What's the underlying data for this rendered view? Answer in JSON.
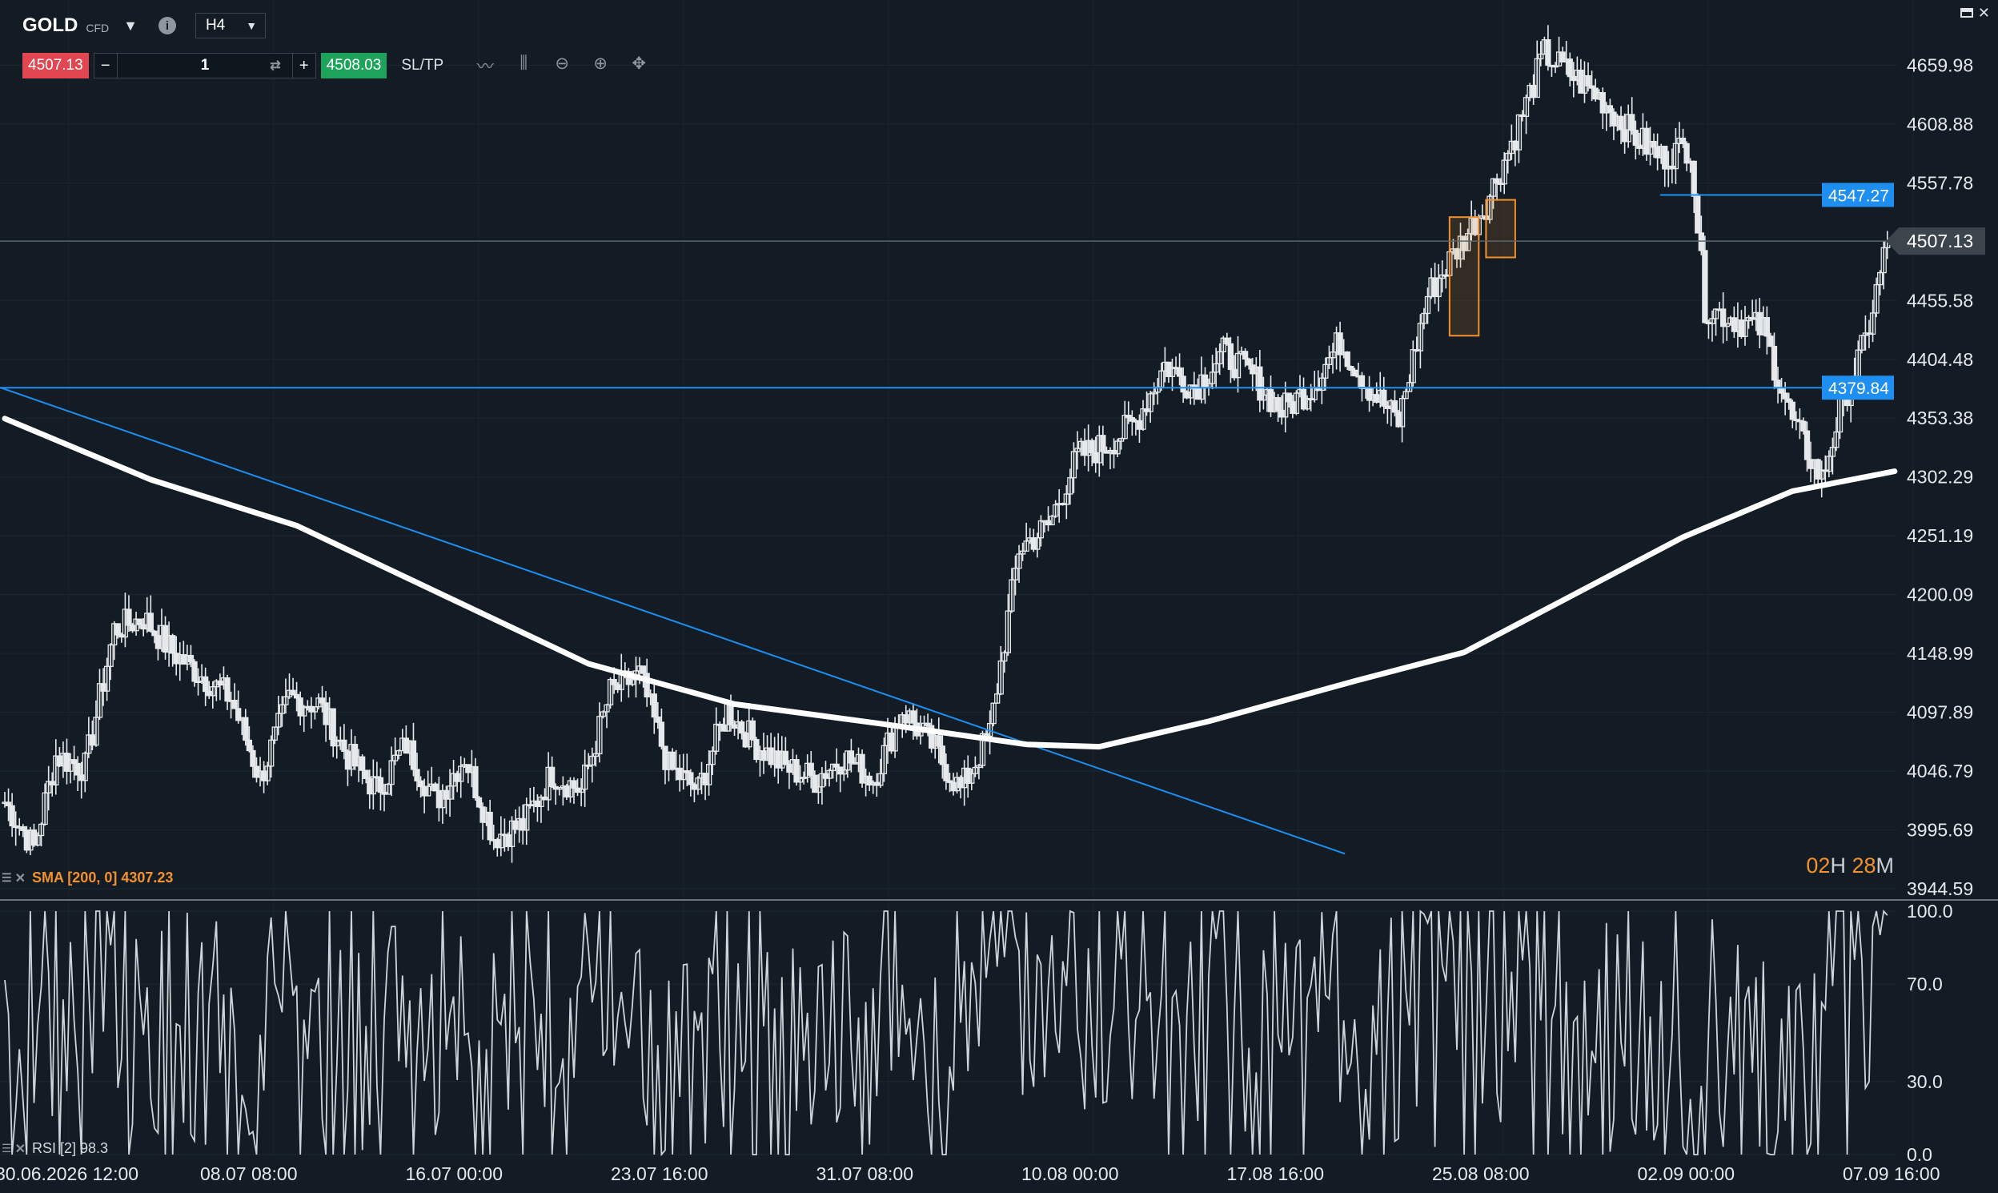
{
  "header": {
    "symbol": "GOLD",
    "instrument_type": "CFD",
    "timeframe": "H4"
  },
  "trade_panel": {
    "sell_price": "4507.13",
    "buy_price": "4508.03",
    "quantity": "1",
    "minus": "−",
    "plus": "+",
    "sltp_label": "SL/TP"
  },
  "icons": [
    "chevron-down-icon",
    "info-icon",
    "swap-icon",
    "line-chart-icon",
    "candles-icon",
    "zoom-out-icon",
    "zoom-in-icon",
    "crosshair-icon",
    "minimize-icon",
    "close-icon"
  ],
  "colors": {
    "background": "#131c24",
    "candle": "#e6e9ec",
    "sma": "#ffffff",
    "horizontal_line": "#1e8ef0",
    "sell": "#e24650",
    "buy": "#1da35a",
    "accent": "#f2912e"
  },
  "indicators": {
    "sma_label": "SMA [200, 0] 4307.23",
    "rsi_label": "RSI [2] 98.3"
  },
  "countdown": {
    "hours": "02",
    "hours_unit": "H",
    "minutes": "28",
    "minutes_unit": "M"
  },
  "chart_data": [
    {
      "type": "candlestick",
      "symbol": "GOLD",
      "timeframe": "H4",
      "y_axis_labels": [
        "4659.98",
        "4608.88",
        "4557.78",
        "4507.13",
        "4455.58",
        "4404.48",
        "4353.38",
        "4302.29",
        "4251.19",
        "4200.09",
        "4148.99",
        "4097.89",
        "4046.79",
        "3995.69",
        "3944.59"
      ],
      "x_axis_labels": [
        "30.06.2026 12:00",
        "08.07 08:00",
        "16.07 00:00",
        "23.07 16:00",
        "31.07 08:00",
        "10.08 00:00",
        "17.08 16:00",
        "25.08 08:00",
        "02.09 00:00",
        "07.09 16:00"
      ],
      "ylim": [
        3944.59,
        4718
      ],
      "current_price": 4507.13,
      "horizontal_lines": [
        {
          "label": "4547.27",
          "price": 4547.27
        },
        {
          "label": "4379.84",
          "price": 4379.84
        }
      ],
      "close_path": [
        [
          0,
          4020
        ],
        [
          8,
          3980
        ],
        [
          14,
          4060
        ],
        [
          22,
          4050
        ],
        [
          30,
          4170
        ],
        [
          38,
          4180
        ],
        [
          46,
          4150
        ],
        [
          54,
          4130
        ],
        [
          62,
          4110
        ],
        [
          70,
          4040
        ],
        [
          78,
          4110
        ],
        [
          86,
          4105
        ],
        [
          94,
          4060
        ],
        [
          102,
          4030
        ],
        [
          110,
          4070
        ],
        [
          118,
          4020
        ],
        [
          126,
          4060
        ],
        [
          134,
          3990
        ],
        [
          142,
          4000
        ],
        [
          150,
          4045
        ],
        [
          158,
          4030
        ],
        [
          166,
          4115
        ],
        [
          174,
          4130
        ],
        [
          182,
          4050
        ],
        [
          190,
          4030
        ],
        [
          198,
          4100
        ],
        [
          206,
          4070
        ],
        [
          214,
          4050
        ],
        [
          222,
          4040
        ],
        [
          230,
          4060
        ],
        [
          238,
          4040
        ],
        [
          246,
          4100
        ],
        [
          254,
          4070
        ],
        [
          262,
          4030
        ],
        [
          270,
          4080
        ],
        [
          278,
          4240
        ],
        [
          286,
          4260
        ],
        [
          294,
          4320
        ],
        [
          302,
          4330
        ],
        [
          310,
          4350
        ],
        [
          318,
          4400
        ],
        [
          326,
          4380
        ],
        [
          334,
          4410
        ],
        [
          342,
          4390
        ],
        [
          350,
          4360
        ],
        [
          358,
          4380
        ],
        [
          366,
          4420
        ],
        [
          374,
          4380
        ],
        [
          382,
          4350
        ],
        [
          390,
          4460
        ],
        [
          398,
          4500
        ],
        [
          406,
          4540
        ],
        [
          414,
          4600
        ],
        [
          422,
          4670
        ],
        [
          430,
          4650
        ],
        [
          438,
          4630
        ],
        [
          446,
          4600
        ],
        [
          454,
          4580
        ],
        [
          462,
          4590
        ],
        [
          466,
          4450
        ],
        [
          474,
          4440
        ],
        [
          482,
          4430
        ],
        [
          490,
          4350
        ],
        [
          498,
          4300
        ],
        [
          504,
          4370
        ],
        [
          510,
          4420
        ],
        [
          516,
          4507.13
        ]
      ],
      "highlighted_candle_boxes": [
        {
          "x": [
            396,
            404
          ],
          "y": [
            4425,
            4528
          ]
        },
        {
          "x": [
            406,
            414
          ],
          "y": [
            4493,
            4543
          ]
        }
      ],
      "trendline": {
        "from": [
          0,
          4380
        ],
        "to": [
          366,
          3975
        ]
      },
      "sma": {
        "name": "SMA [200, 0] 4307.23",
        "points": [
          [
            0,
            4353
          ],
          [
            40,
            4300
          ],
          [
            80,
            4260
          ],
          [
            120,
            4200
          ],
          [
            160,
            4140
          ],
          [
            200,
            4105
          ],
          [
            240,
            4088
          ],
          [
            280,
            4070
          ],
          [
            300,
            4068
          ],
          [
            330,
            4090
          ],
          [
            370,
            4125
          ],
          [
            400,
            4150
          ],
          [
            430,
            4200
          ],
          [
            460,
            4250
          ],
          [
            490,
            4290
          ],
          [
            518,
            4307.23
          ]
        ]
      }
    },
    {
      "type": "line",
      "name": "RSI [2] 98.3",
      "y_axis_labels": [
        "100.0",
        "70.0",
        "30.0",
        "0.0"
      ],
      "ylim": [
        0,
        100
      ],
      "last_value": 98.3
    }
  ]
}
